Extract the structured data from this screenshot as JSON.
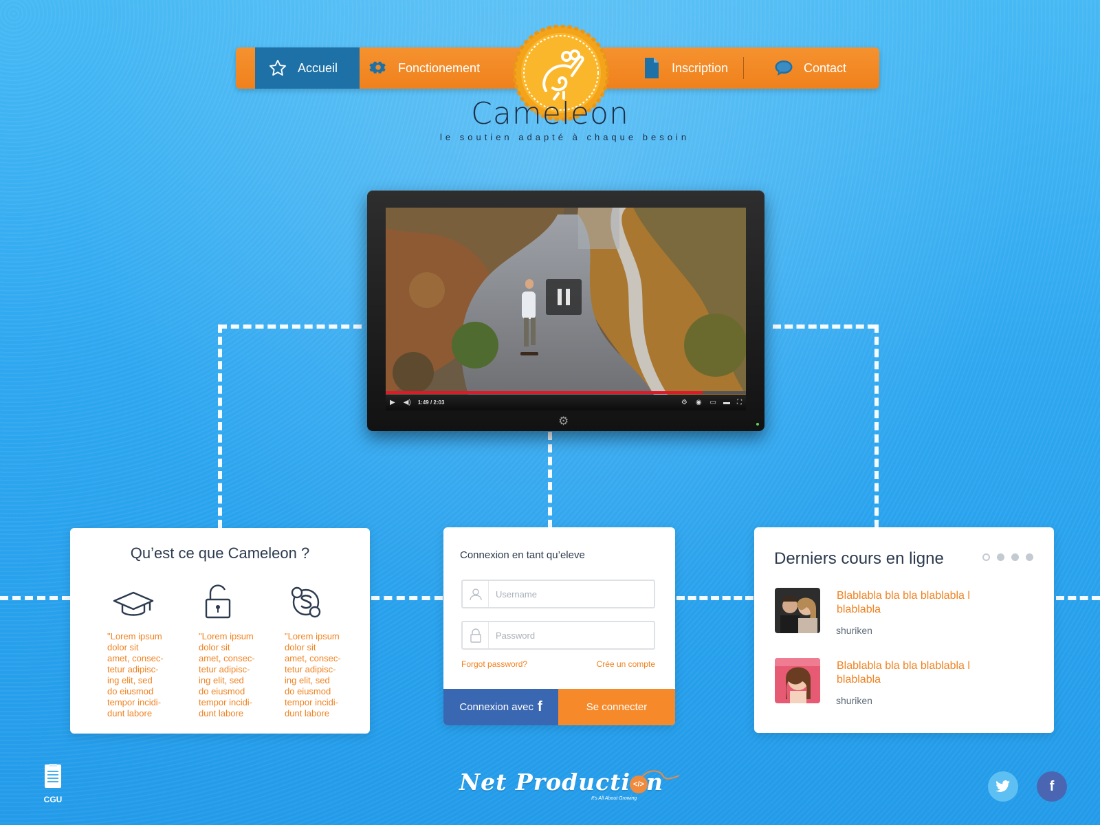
{
  "nav": {
    "items": [
      {
        "label": "Accueil",
        "icon": "star-icon",
        "active": true
      },
      {
        "label": "Fonctionement",
        "icon": "gear-icon",
        "active": false
      },
      {
        "label": "Inscription",
        "icon": "document-icon",
        "active": false
      },
      {
        "label": "Contact",
        "icon": "chat-bubble-icon",
        "active": false
      }
    ]
  },
  "brand": {
    "name": "Cameleon",
    "tagline": "le soutien adapté à chaque besoin"
  },
  "video": {
    "time": "1:49 / 2:03",
    "progress": 0.88,
    "state": "paused"
  },
  "about": {
    "title": "Qu’est ce que Cameleon ?",
    "features": [
      {
        "icon": "graduation-cap-icon",
        "text": "\"Lorem ipsum\ndolor sit\namet, consec-\ntetur adipisc-\ning elit, sed\ndo eiusmod\ntempor incidi-\ndunt labore"
      },
      {
        "icon": "unlocked-padlock-icon",
        "text": "\"Lorem ipsum\ndolor sit\namet, consec-\ntetur adipisc-\ning elit, sed\ndo eiusmod\ntempor incidi-\ndunt labore"
      },
      {
        "icon": "skype-icon",
        "text": "\"Lorem ipsum\ndolor sit\namet, consec-\ntetur adipisc-\ning elit, sed\ndo eiusmod\ntempor incidi-\ndunt labore"
      }
    ]
  },
  "login": {
    "title": "Connexion en tant qu’eleve",
    "username_placeholder": "Username",
    "password_placeholder": "Password",
    "forgot": "Forgot password?",
    "create": "Crée un compte",
    "facebook_button": "Connexion avec",
    "submit_button": "Se connecter"
  },
  "courses": {
    "title": "Derniers cours en ligne",
    "active_dot": 0,
    "dot_count": 4,
    "items": [
      {
        "title": "Blablabla bla bla blablabla l blablabla",
        "author": "shuriken"
      },
      {
        "title": "Blablabla bla bla blablabla l blablabla",
        "author": "shuriken"
      }
    ]
  },
  "footer": {
    "cgu": "CGU",
    "logo_name": "Net Production",
    "logo_slogan": "It's All About Growing"
  },
  "colors": {
    "accent": "#f0811c",
    "nav_active": "#1e71a6",
    "facebook": "#3a67b2",
    "background": "#2ea7f0"
  }
}
